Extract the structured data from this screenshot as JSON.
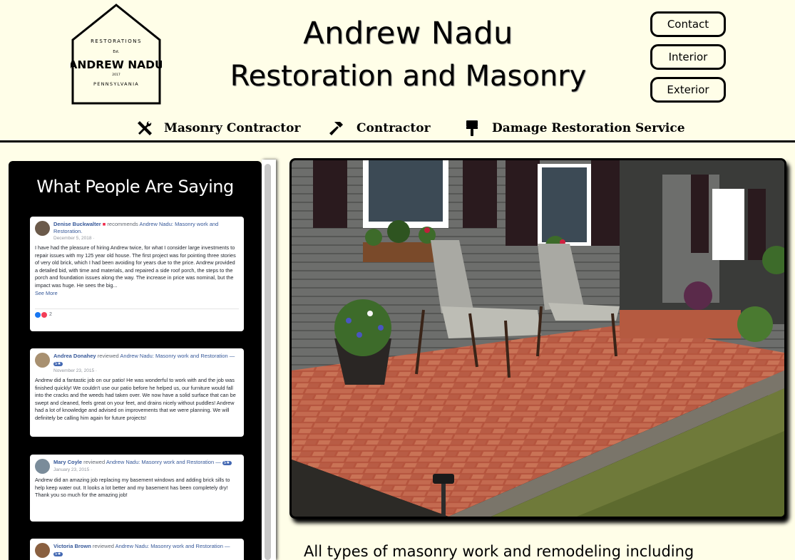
{
  "logo": {
    "top_arc": "RESTORATIONS",
    "est": "Est.",
    "name": "ANDREW NADU",
    "year": "2017",
    "bottom_arc": "PENNSYLVANIA"
  },
  "header": {
    "title": "Andrew Nadu",
    "subtitle": "Restoration and Masonry"
  },
  "nav": {
    "contact": "Contact",
    "interior": "Interior",
    "exterior": "Exterior"
  },
  "services": [
    {
      "label": "Masonry Contractor",
      "icon": "tools-icon"
    },
    {
      "label": "Contractor",
      "icon": "hammer-icon"
    },
    {
      "label": "Damage Restoration Service",
      "icon": "paint-roller-icon"
    }
  ],
  "reviews": {
    "heading": "What People Are Saying",
    "items": [
      {
        "author": "Denise Buckwalter",
        "action": "recommends",
        "page": "Andrew Nadu: Masonry work and Restoration.",
        "date": "December 5, 2018 ·",
        "text": "I have had the pleasure of hiring Andrew twice, for what I consider large investments to repair issues with my 125 year old house. The first project was for pointing three stories of very old brick, which I had been avoiding for years due to the price. Andrew provided a detailed bid, with time and materials, and repaired a side roof porch, the steps to the porch and foundation issues along the way. The increase in price was nominal, but the impact was huge. He sees the big...",
        "more": "See More",
        "reactions": "2"
      },
      {
        "author": "Andrea Donahey",
        "action": "reviewed",
        "page": "Andrew Nadu: Masonry work and Restoration —",
        "badge": "5★",
        "date": "November 23, 2015 ·",
        "text": "Andrew did a fantastic job on our patio! He was wonderful to work with and the job was finished quickly! We couldn't use our patio before he helped us, our furniture would fall into the cracks and the weeds had taken over. We now have a solid surface that can be swept and cleaned, feels great on your feet, and drains nicely without puddles! Andrew had a lot of knowledge and advised on improvements that we were planning. We will definitely be calling him again for future projects!"
      },
      {
        "author": "Mary Coyle",
        "action": "reviewed",
        "page": "Andrew Nadu: Masonry work and Restoration —",
        "badge": "5★",
        "date": "January 23, 2015 ·",
        "text": "Andrew did an amazing job replacing my basement windows and adding brick sills to help keep water out. It looks a lot better and my basement has been completely dry! Thank you so much for the amazing job!"
      },
      {
        "author": "Victoria Brown",
        "action": "reviewed",
        "page": "Andrew Nadu: Masonry work and Restoration —",
        "badge": "5★",
        "date": "",
        "text": ""
      }
    ]
  },
  "main": {
    "intro": "All types of masonry work and remodeling including"
  },
  "colors": {
    "page_bg": "#fffee8",
    "panel_bg": "#000000",
    "link_blue": "#365899"
  }
}
